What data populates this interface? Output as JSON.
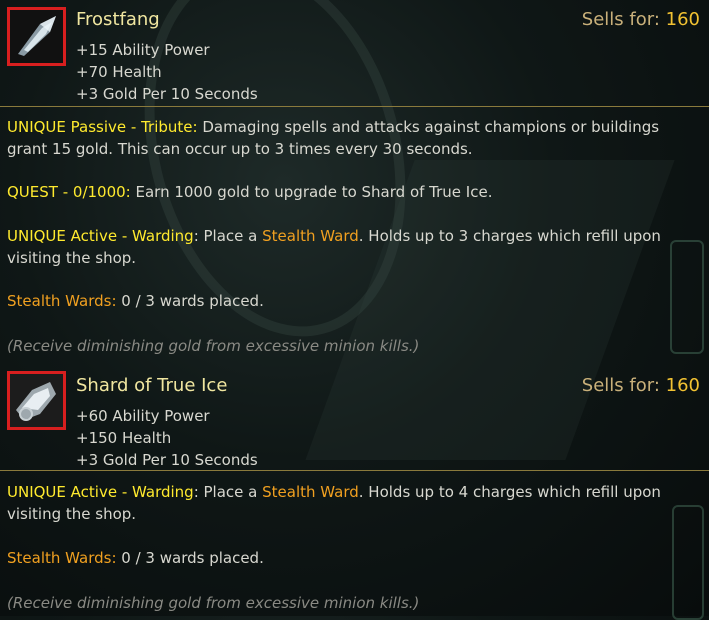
{
  "items": [
    {
      "name": "Frostfang",
      "sells_label": "Sells for:",
      "sells_price": "160",
      "stats": [
        "+15 Ability Power",
        "+70 Health",
        "+3 Gold Per 10 Seconds"
      ],
      "passive": {
        "label": "UNIQUE Passive - Tribute:",
        "text": " Damaging spells and attacks against champions or buildings grant 15 gold.  This can occur up to 3 times every 30 seconds."
      },
      "quest": {
        "label": "QUEST - 0/1000:",
        "text": " Earn 1000 gold to upgrade to Shard of True Ice."
      },
      "active": {
        "label": "UNIQUE Active - Warding",
        "text1": ": Place a ",
        "ward": "Stealth Ward",
        "text2": ".  Holds up to 3 charges which refill upon visiting the shop."
      },
      "wards": {
        "label": "Stealth Wards:",
        "text": " 0 / 3 wards placed."
      },
      "note": "(Receive diminishing gold from excessive minion kills.)"
    },
    {
      "name": "Shard of True Ice",
      "sells_label": "Sells for:",
      "sells_price": "160",
      "stats": [
        "+60 Ability Power",
        "+150 Health",
        "+3 Gold Per 10 Seconds"
      ],
      "active": {
        "label": "UNIQUE Active - Warding",
        "text1": ": Place a ",
        "ward": "Stealth Ward",
        "text2": ".  Holds up to 4 charges which refill upon visiting the shop."
      },
      "wards": {
        "label": "Stealth Wards:",
        "text": " 0 / 3 wards placed."
      },
      "note": "(Receive diminishing gold from excessive minion kills.)"
    }
  ],
  "colors": {
    "border": "#d81f1f",
    "divider": "#8a7a3c",
    "price": "#f2c232",
    "keyword": "#ffea2e",
    "ward": "#f0a020"
  }
}
